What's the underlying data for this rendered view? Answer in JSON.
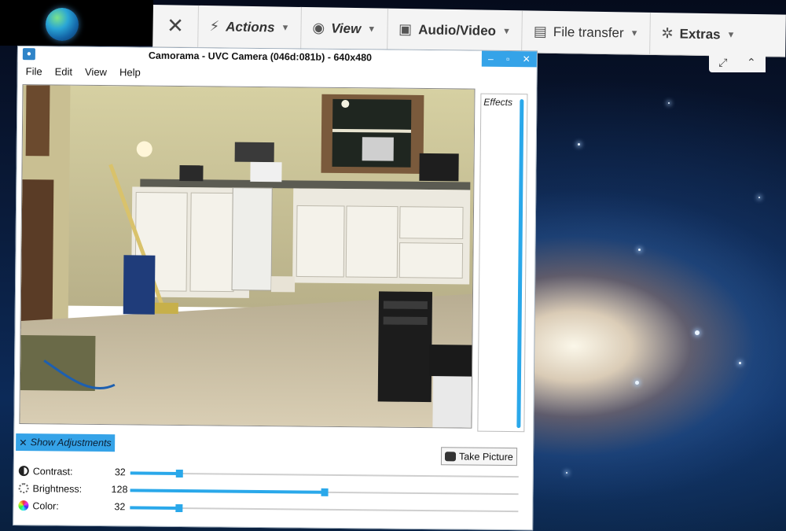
{
  "toolbar": {
    "close_glyph": "✕",
    "items": [
      {
        "label": "Actions",
        "icon": "lightning-icon",
        "glyph": "⚡"
      },
      {
        "label": "View",
        "icon": "eye-icon",
        "glyph": "◉"
      },
      {
        "label": "Audio/Video",
        "icon": "chat-icon",
        "glyph": "▣"
      },
      {
        "label": "File transfer",
        "icon": "files-icon",
        "glyph": "▤"
      },
      {
        "label": "Extras",
        "icon": "gears-icon",
        "glyph": "✲"
      }
    ],
    "caret": "▼",
    "sub_fullscreen": "⤢",
    "sub_collapse": "⌃"
  },
  "window": {
    "title": "Camorama - UVC Camera (046d:081b) - 640x480",
    "menu": [
      "File",
      "Edit",
      "View",
      "Help"
    ],
    "controls": [
      "–",
      "▫",
      "✕"
    ],
    "effects_label": "Effects",
    "show_adjustments": "Show Adjustments",
    "take_picture": "Take Picture",
    "adjustments": [
      {
        "label": "Contrast:",
        "value": "32",
        "fraction": 0.125,
        "icon": "contrast-icon",
        "color": "#222222"
      },
      {
        "label": "Brightness:",
        "value": "128",
        "fraction": 0.5,
        "icon": "brightness-icon",
        "color": "#666666"
      },
      {
        "label": "Color:",
        "value": "32",
        "fraction": 0.125,
        "icon": "color-wheel-icon",
        "color": "#d23ad0"
      }
    ]
  },
  "colors": {
    "accent": "#35a3e8",
    "toolbar_bg": "#f4f4f4",
    "wallpaper_dark": "#0a1b3a"
  }
}
